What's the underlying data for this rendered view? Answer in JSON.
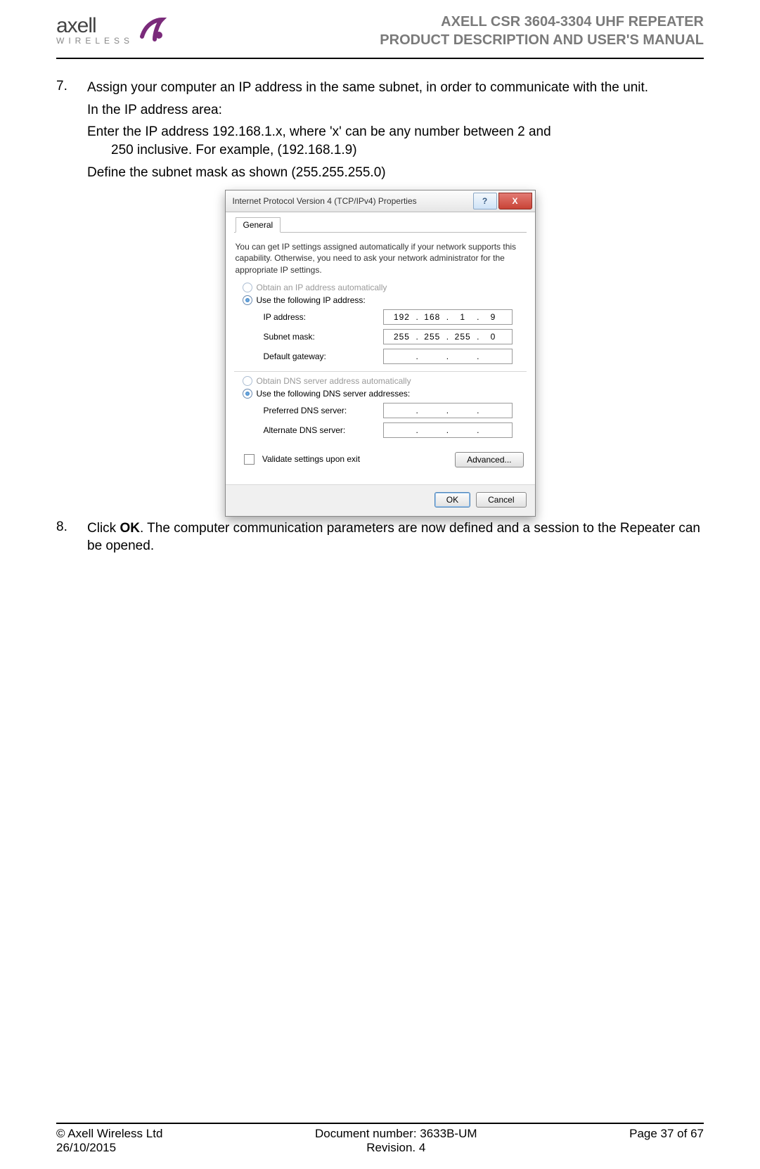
{
  "header": {
    "logo_main": "axell",
    "logo_sub": "WIRELESS",
    "title_line1": "AXELL CSR 3604-3304 UHF REPEATER",
    "title_line2": "PRODUCT DESCRIPTION AND USER'S MANUAL"
  },
  "steps": {
    "s7": {
      "num": "7.",
      "line1": "Assign your computer an IP address in the same subnet, in order to communicate with the unit.",
      "line2": "In the IP address area:",
      "line3a": "Enter the IP address 192.168.1.x, where 'x' can be any number between 2 and",
      "line3b": "250 inclusive. For example,  (192.168.1.9)",
      "line4": "Define the subnet mask as shown (255.255.255.0)"
    },
    "s8": {
      "num": "8.",
      "text_pre": "Click ",
      "bold": "OK",
      "text_post": ". The computer communication parameters are now defined and a session to the Repeater can be opened."
    }
  },
  "dialog": {
    "title": "Internet Protocol Version 4 (TCP/IPv4) Properties",
    "help": "?",
    "close": "X",
    "tab": "General",
    "description": "You can get IP settings assigned automatically if your network supports this capability. Otherwise, you need to ask your network administrator for the appropriate IP settings.",
    "radio_obtain_ip": "Obtain an IP address automatically",
    "radio_use_ip": "Use the following IP address:",
    "ip_label": "IP address:",
    "subnet_label": "Subnet mask:",
    "gateway_label": "Default gateway:",
    "ip": {
      "o1": "192",
      "o2": "168",
      "o3": "1",
      "o4": "9"
    },
    "subnet": {
      "o1": "255",
      "o2": "255",
      "o3": "255",
      "o4": "0"
    },
    "gateway": {
      "o1": "",
      "o2": "",
      "o3": "",
      "o4": ""
    },
    "radio_obtain_dns": "Obtain DNS server address automatically",
    "radio_use_dns": "Use the following DNS server addresses:",
    "pref_dns_label": "Preferred DNS server:",
    "alt_dns_label": "Alternate DNS server:",
    "pref_dns": {
      "o1": "",
      "o2": "",
      "o3": "",
      "o4": ""
    },
    "alt_dns": {
      "o1": "",
      "o2": "",
      "o3": "",
      "o4": ""
    },
    "validate_label": "Validate settings upon exit",
    "advanced_btn": "Advanced...",
    "ok_btn": "OK",
    "cancel_btn": "Cancel"
  },
  "footer": {
    "left1": "© Axell Wireless Ltd",
    "left2": "26/10/2015",
    "mid1": "Document number: 3633B-UM",
    "mid2": "Revision. 4",
    "right": "Page 37 of 67"
  }
}
